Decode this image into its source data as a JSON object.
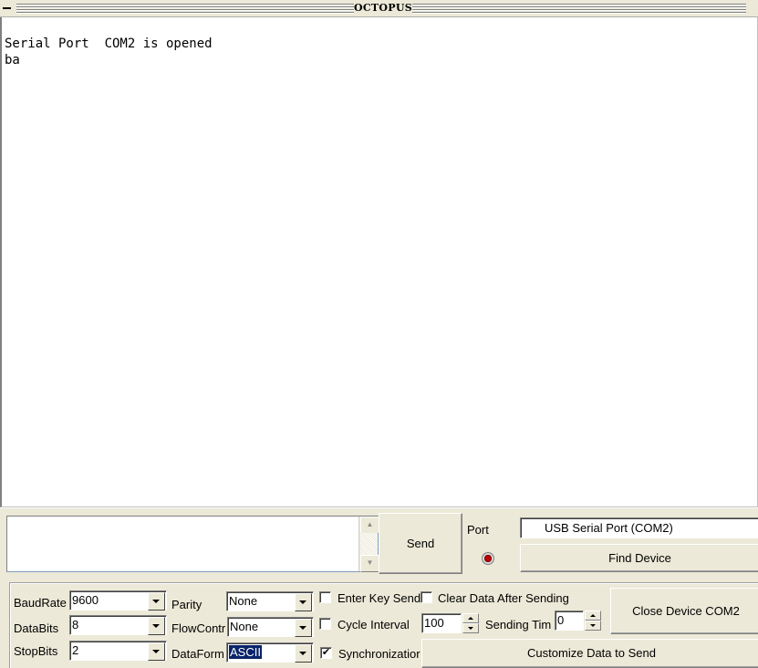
{
  "window": {
    "title": "OCTOPUS"
  },
  "output": {
    "lines": [
      "Serial Port  COM2 is opened",
      "ba"
    ]
  },
  "send": {
    "text": "",
    "button_label": "Send"
  },
  "port": {
    "label": "Port",
    "selected": "USB Serial Port (COM2)",
    "find_button_label": "Find Device",
    "led_color": "#c00000"
  },
  "settings": {
    "baud_rate": {
      "label": "BaudRate",
      "value": "9600"
    },
    "data_bits": {
      "label": "DataBits",
      "value": "8"
    },
    "stop_bits": {
      "label": "StopBits",
      "value": "2"
    },
    "parity": {
      "label": "Parity",
      "value": "None"
    },
    "flow_control": {
      "label": "FlowContr",
      "value": "None"
    },
    "data_format": {
      "label": "DataForm",
      "value": "ASCII"
    }
  },
  "options": {
    "enter_key_send": {
      "label": "Enter Key Send",
      "checked": false
    },
    "clear_after_sending": {
      "label": "Clear Data After Sending",
      "checked": false
    },
    "cycle_interval": {
      "label": "Cycle Interval",
      "checked": false,
      "value": "100"
    },
    "sending_times": {
      "label": "Sending Tim",
      "value": "0"
    },
    "synchronization": {
      "label": "Synchronizatior",
      "checked": true,
      "check_glyph": "✔"
    }
  },
  "actions": {
    "close_device_label": "Close Device COM2",
    "customize_label": "Customize Data to Send"
  },
  "icons": {
    "scroll_up": "▲",
    "scroll_down": "▼"
  }
}
